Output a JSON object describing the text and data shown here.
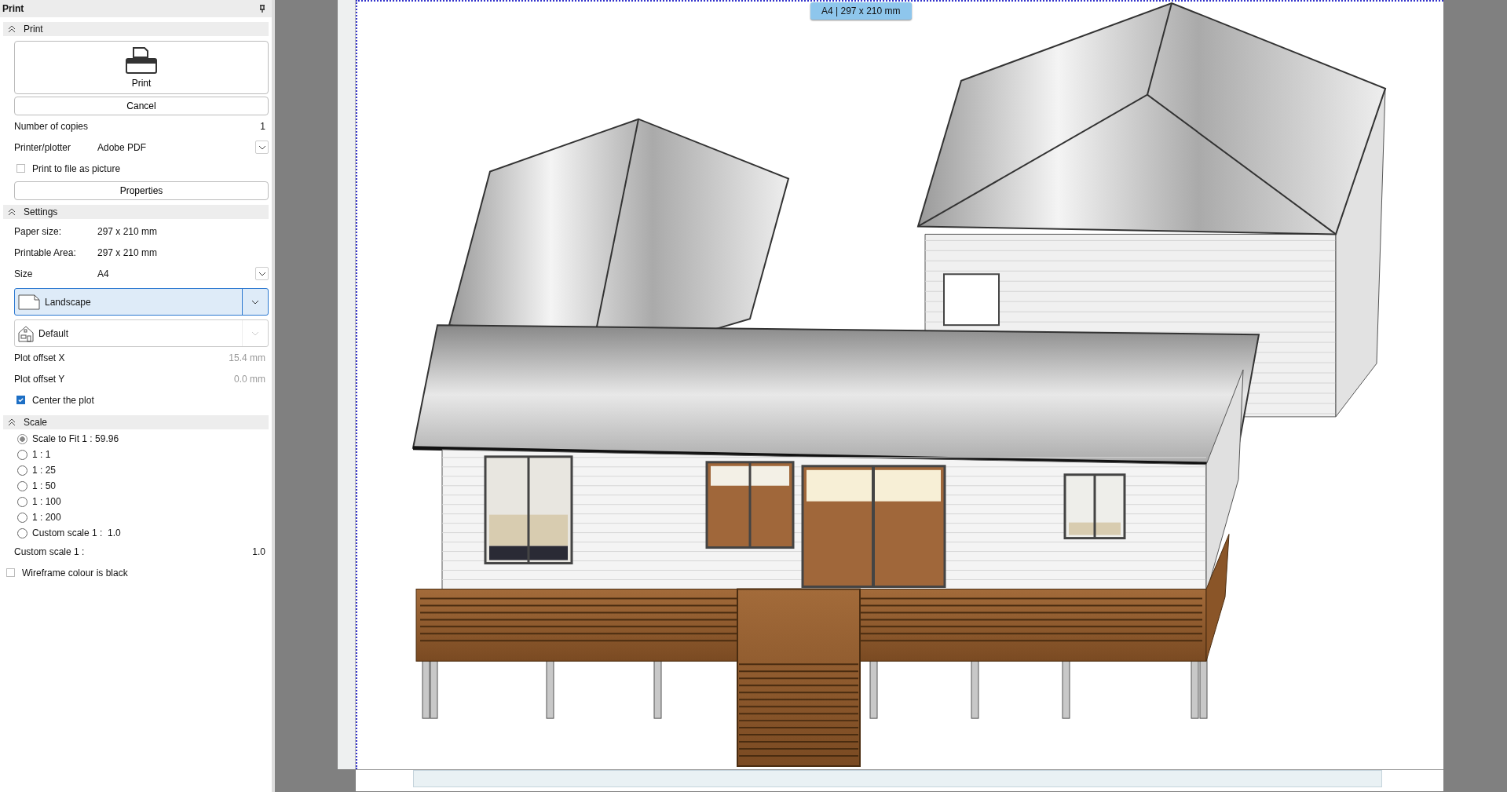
{
  "panel": {
    "title": "Print"
  },
  "print_section": {
    "title": "Print",
    "expanded": true,
    "print_button": "Print",
    "cancel_button": "Cancel",
    "copies": {
      "label": "Number of copies",
      "value": "1"
    },
    "printer": {
      "label": "Printer/plotter",
      "value": "Adobe PDF"
    },
    "print_to_file": {
      "label": "Print to file as picture",
      "checked": false
    },
    "properties_button": "Properties"
  },
  "settings_section": {
    "title": "Settings",
    "expanded": true,
    "paper_size": {
      "label": "Paper size:",
      "value": "297 x 210 mm"
    },
    "printable_area": {
      "label": "Printable Area:",
      "value": "297 x 210 mm"
    },
    "size": {
      "label": "Size",
      "value": "A4"
    },
    "orientation": {
      "value": "Landscape",
      "selected": true
    },
    "style": {
      "value": "Default",
      "selected": false
    },
    "offset_x": {
      "label": "Plot offset X",
      "value": "15.4 mm",
      "disabled": true
    },
    "offset_y": {
      "label": "Plot offset Y",
      "value": "0.0 mm",
      "disabled": true
    },
    "center": {
      "label": "Center the plot",
      "checked": true
    }
  },
  "scale_section": {
    "title": "Scale",
    "expanded": true,
    "options": [
      {
        "label": "Scale to Fit 1 : 59.96",
        "selected": true
      },
      {
        "label": "1 : 1",
        "selected": false
      },
      {
        "label": "1 : 25",
        "selected": false
      },
      {
        "label": "1 : 50",
        "selected": false
      },
      {
        "label": "1 : 100",
        "selected": false
      },
      {
        "label": "1 : 200",
        "selected": false
      },
      {
        "label": "Custom scale 1 :  1.0",
        "selected": false
      }
    ],
    "custom": {
      "label": "Custom scale 1 :",
      "value": "1.0"
    },
    "wireframe": {
      "label": "Wireframe colour is black",
      "checked": false
    }
  },
  "preview": {
    "page_label": "A4 | 297 x 210 mm"
  }
}
